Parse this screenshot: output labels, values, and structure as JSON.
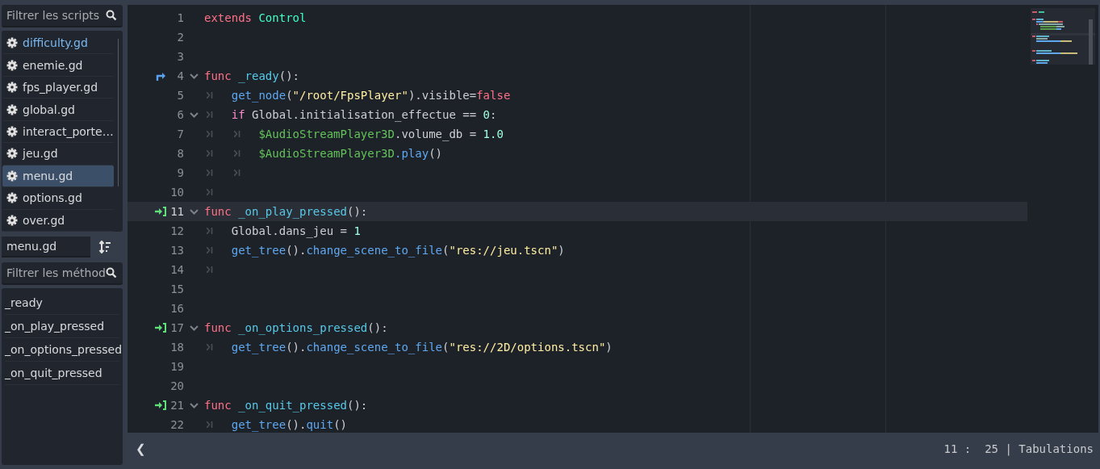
{
  "script_filter": {
    "placeholder": "Filtrer les scripts"
  },
  "scripts": [
    {
      "name": "difficulty.gd",
      "selected": false,
      "emphasized": true
    },
    {
      "name": "enemie.gd",
      "selected": false,
      "emphasized": false
    },
    {
      "name": "fps_player.gd",
      "selected": false,
      "emphasized": false
    },
    {
      "name": "global.gd",
      "selected": false,
      "emphasized": false
    },
    {
      "name": "interact_porte…",
      "selected": false,
      "emphasized": false
    },
    {
      "name": "jeu.gd",
      "selected": false,
      "emphasized": false
    },
    {
      "name": "menu.gd",
      "selected": true,
      "emphasized": false
    },
    {
      "name": "options.gd",
      "selected": false,
      "emphasized": false
    },
    {
      "name": "over.gd",
      "selected": false,
      "emphasized": false
    }
  ],
  "current_script": "menu.gd",
  "method_filter": {
    "placeholder": "Filtrer les méthod"
  },
  "methods": [
    "_ready",
    "_on_play_pressed",
    "_on_options_pressed",
    "_on_quit_pressed"
  ],
  "lines": [
    {
      "number": "1",
      "fold": false,
      "current": false,
      "tokens": [
        {
          "kind": "keyword",
          "text": "extends"
        },
        {
          "kind": "space"
        },
        {
          "kind": "class",
          "text": "Control"
        }
      ]
    },
    {
      "number": "2",
      "fold": false,
      "current": false
    },
    {
      "number": "3",
      "fold": false,
      "current": false
    },
    {
      "number": "4",
      "kind": "override",
      "fold": true,
      "current": false,
      "tokens": [
        {
          "kind": "keyword",
          "text": "func"
        },
        {
          "kind": "space"
        },
        {
          "kind": "member",
          "text": "_ready"
        },
        {
          "kind": "plain",
          "text": "():"
        }
      ]
    },
    {
      "number": "5",
      "fold": false,
      "current": false,
      "tokens": [
        {
          "kind": "tab"
        },
        {
          "kind": "call",
          "text": "get_node"
        },
        {
          "kind": "plain",
          "text": "("
        },
        {
          "kind": "string",
          "text": "\"/root/FpsPlayer\""
        },
        {
          "kind": "plain",
          "text": ").visible="
        },
        {
          "kind": "keyword",
          "text": "false"
        }
      ]
    },
    {
      "number": "6",
      "fold": true,
      "current": false,
      "tokens": [
        {
          "kind": "tab"
        },
        {
          "kind": "control",
          "text": "if"
        },
        {
          "kind": "plain",
          "text": " Global.initialisation_effectue == "
        },
        {
          "kind": "number",
          "text": "0"
        },
        {
          "kind": "plain",
          "text": ":"
        }
      ]
    },
    {
      "number": "7",
      "fold": false,
      "current": false,
      "tokens": [
        {
          "kind": "tab"
        },
        {
          "kind": "tab"
        },
        {
          "kind": "nodepath",
          "text": "$AudioStreamPlayer3D"
        },
        {
          "kind": "plain",
          "text": ".volume_db = "
        },
        {
          "kind": "number",
          "text": "1.0"
        }
      ]
    },
    {
      "number": "8",
      "fold": false,
      "current": false,
      "tokens": [
        {
          "kind": "tab"
        },
        {
          "kind": "tab"
        },
        {
          "kind": "nodepath",
          "text": "$AudioStreamPlayer3D"
        },
        {
          "kind": "call",
          "text": ".play"
        },
        {
          "kind": "plain",
          "text": "()"
        }
      ]
    },
    {
      "number": "9",
      "fold": false,
      "current": false,
      "tokens": [
        {
          "kind": "tab"
        },
        {
          "kind": "tab"
        }
      ]
    },
    {
      "number": "10",
      "fold": false,
      "current": false,
      "tokens": [
        {
          "kind": "tab"
        }
      ]
    },
    {
      "number": "11",
      "kind": "signal",
      "fold": true,
      "current": true,
      "tokens": [
        {
          "kind": "keyword",
          "text": "func"
        },
        {
          "kind": "space"
        },
        {
          "kind": "member",
          "text": "_on_play_pressed"
        },
        {
          "kind": "plain",
          "text": "():"
        }
      ]
    },
    {
      "number": "12",
      "fold": false,
      "current": false,
      "tokens": [
        {
          "kind": "tab"
        },
        {
          "kind": "plain",
          "text": "Global.dans_jeu = "
        },
        {
          "kind": "number",
          "text": "1"
        }
      ]
    },
    {
      "number": "13",
      "fold": false,
      "current": false,
      "tokens": [
        {
          "kind": "tab"
        },
        {
          "kind": "call",
          "text": "get_tree"
        },
        {
          "kind": "plain",
          "text": "()."
        },
        {
          "kind": "call",
          "text": "change_scene_to_file"
        },
        {
          "kind": "plain",
          "text": "("
        },
        {
          "kind": "string",
          "text": "\"res://jeu.tscn\""
        },
        {
          "kind": "plain",
          "text": ")"
        }
      ]
    },
    {
      "number": "14",
      "fold": false,
      "current": false,
      "tokens": [
        {
          "kind": "tab"
        }
      ]
    },
    {
      "number": "15",
      "fold": false,
      "current": false
    },
    {
      "number": "16",
      "fold": false,
      "current": false
    },
    {
      "number": "17",
      "kind": "signal",
      "fold": true,
      "current": false,
      "tokens": [
        {
          "kind": "keyword",
          "text": "func"
        },
        {
          "kind": "space"
        },
        {
          "kind": "member",
          "text": "_on_options_pressed"
        },
        {
          "kind": "plain",
          "text": "():"
        }
      ]
    },
    {
      "number": "18",
      "fold": false,
      "current": false,
      "tokens": [
        {
          "kind": "tab"
        },
        {
          "kind": "call",
          "text": "get_tree"
        },
        {
          "kind": "plain",
          "text": "()."
        },
        {
          "kind": "call",
          "text": "change_scene_to_file"
        },
        {
          "kind": "plain",
          "text": "("
        },
        {
          "kind": "string",
          "text": "\"res://2D/options.tscn\""
        },
        {
          "kind": "plain",
          "text": ")"
        }
      ]
    },
    {
      "number": "19",
      "fold": false,
      "current": false
    },
    {
      "number": "20",
      "fold": false,
      "current": false
    },
    {
      "number": "21",
      "kind": "signal",
      "fold": true,
      "current": false,
      "tokens": [
        {
          "kind": "keyword",
          "text": "func"
        },
        {
          "kind": "space"
        },
        {
          "kind": "member",
          "text": "_on_quit_pressed"
        },
        {
          "kind": "plain",
          "text": "():"
        }
      ]
    },
    {
      "number": "22",
      "fold": false,
      "current": false,
      "tokens": [
        {
          "kind": "tab"
        },
        {
          "kind": "call",
          "text": "get_tree"
        },
        {
          "kind": "plain",
          "text": "()."
        },
        {
          "kind": "call",
          "text": "quit"
        },
        {
          "kind": "plain",
          "text": "()"
        }
      ]
    }
  ],
  "status": {
    "toggle": "❮",
    "position": "11 :  25 | Tabulations"
  }
}
